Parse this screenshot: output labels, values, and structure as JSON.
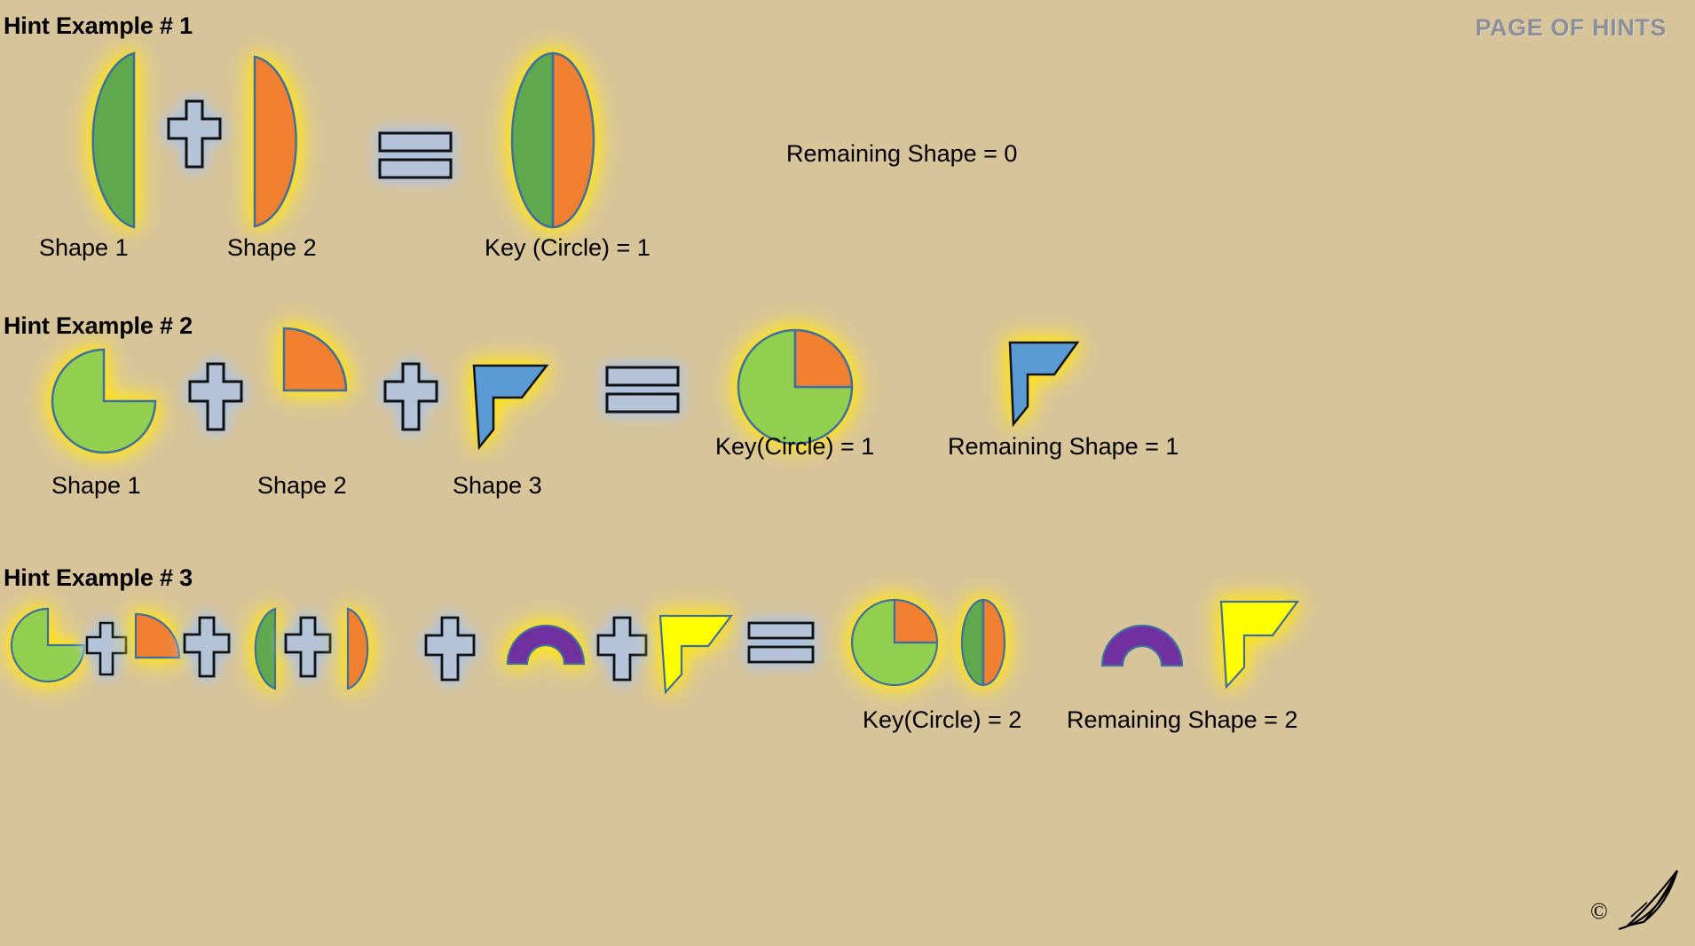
{
  "page": {
    "title": "PAGE OF HINTS",
    "title_color": "#8b8f99",
    "background_color": "#d3bf96",
    "copyright_mark": "©"
  },
  "palette": {
    "green": "#5fa84e",
    "light_green": "#92cf4f",
    "orange": "#f08030",
    "blue": "#5b9bd5",
    "purple": "#7030a0",
    "yellow": "#ffff00",
    "outline": "#3f6f9f",
    "operator_fill": "#b4c3d8",
    "operator_stroke": "#111111",
    "glow_yellow": "#ffe000",
    "glow_blue": "#b8cbe6"
  },
  "examples": [
    {
      "id": "hint-example-1",
      "title": "Hint Example # 1",
      "equation": [
        {
          "kind": "shape",
          "name": "half-circle-green-left",
          "label": "Shape 1"
        },
        {
          "kind": "operator",
          "name": "plus-operator",
          "symbol": "+"
        },
        {
          "kind": "shape",
          "name": "half-circle-orange-right",
          "label": "Shape 2"
        },
        {
          "kind": "operator",
          "name": "equals-operator",
          "symbol": "="
        },
        {
          "kind": "shape",
          "name": "full-circle-green-orange",
          "label": "Key (Circle)  = 1"
        }
      ],
      "result_key_label": "Key (Circle)  = 1",
      "remaining_label": "Remaining Shape = 0",
      "remaining_shapes": []
    },
    {
      "id": "hint-example-2",
      "title": "Hint Example # 2",
      "equation": [
        {
          "kind": "shape",
          "name": "three-quarter-circle-light-green",
          "label": "Shape 1"
        },
        {
          "kind": "operator",
          "name": "plus-operator",
          "symbol": "+"
        },
        {
          "kind": "shape",
          "name": "quarter-circle-orange",
          "label": "Shape 2"
        },
        {
          "kind": "operator",
          "name": "plus-operator",
          "symbol": "+"
        },
        {
          "kind": "shape",
          "name": "flag-polygon-blue",
          "label": "Shape 3"
        },
        {
          "kind": "operator",
          "name": "equals-operator",
          "symbol": "="
        },
        {
          "kind": "shape",
          "name": "circle-light-green-orange-quarter",
          "label": "Key(Circle) = 1"
        }
      ],
      "result_key_label": "Key(Circle) = 1",
      "remaining_label": "Remaining Shape = 1",
      "remaining_shapes": [
        "flag-polygon-blue"
      ]
    },
    {
      "id": "hint-example-3",
      "title": "Hint Example # 3",
      "equation": [
        {
          "kind": "shape",
          "name": "three-quarter-circle-light-green"
        },
        {
          "kind": "operator",
          "name": "plus-operator",
          "symbol": "+"
        },
        {
          "kind": "shape",
          "name": "quarter-circle-orange"
        },
        {
          "kind": "operator",
          "name": "plus-operator",
          "symbol": "+"
        },
        {
          "kind": "shape",
          "name": "half-circle-green-left"
        },
        {
          "kind": "operator",
          "name": "plus-operator",
          "symbol": "+"
        },
        {
          "kind": "shape",
          "name": "half-circle-orange-right"
        },
        {
          "kind": "operator",
          "name": "plus-operator",
          "symbol": "+"
        },
        {
          "kind": "shape",
          "name": "arch-purple"
        },
        {
          "kind": "operator",
          "name": "plus-operator",
          "symbol": "+"
        },
        {
          "kind": "shape",
          "name": "flag-polygon-yellow"
        },
        {
          "kind": "operator",
          "name": "equals-operator",
          "symbol": "="
        },
        {
          "kind": "shape",
          "name": "circle-light-green-orange-quarter"
        },
        {
          "kind": "shape",
          "name": "full-circle-green-orange"
        }
      ],
      "result_key_label": "Key(Circle) = 2",
      "remaining_label": "Remaining Shape = 2",
      "remaining_shapes": [
        "arch-purple",
        "flag-polygon-yellow"
      ]
    }
  ],
  "labels": {
    "shape1": "Shape 1",
    "shape2": "Shape 2",
    "shape3": "Shape 3"
  }
}
